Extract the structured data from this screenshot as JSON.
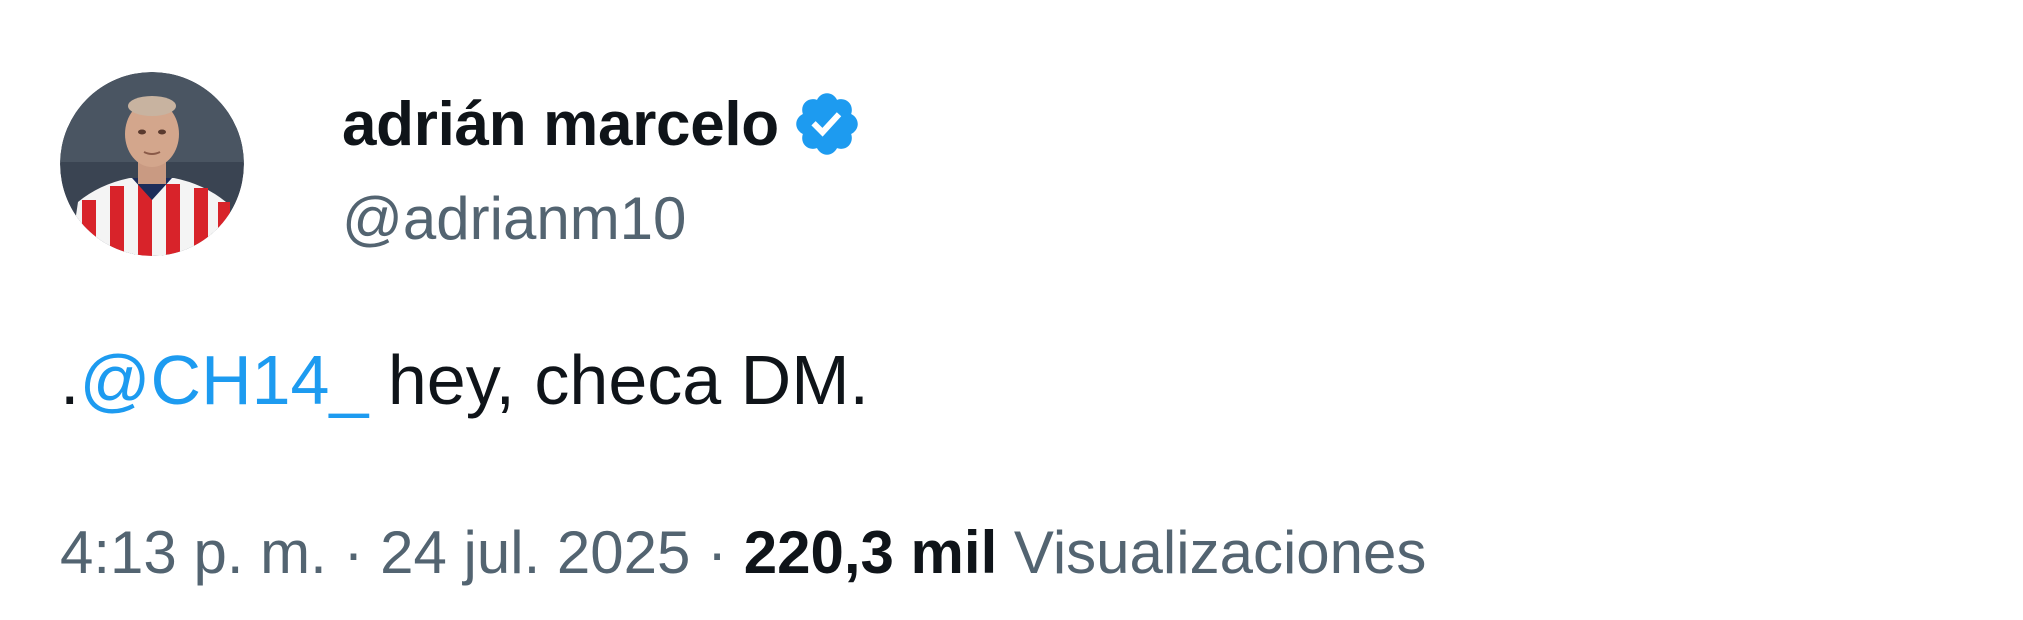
{
  "tweet": {
    "author": {
      "display_name": "adrián marcelo",
      "handle": "@adrianm10",
      "verified": true,
      "avatar_icon": "avatar-photo"
    },
    "text": {
      "prefix": ".",
      "mention": "@CH14_",
      "rest": " hey, checa DM."
    },
    "meta": {
      "time": "4:13 p. m.",
      "separator": " · ",
      "date": "24 jul. 2025",
      "views_count": "220,3 mil",
      "views_label": " Visualizaciones"
    }
  },
  "colors": {
    "text_primary": "#0f1419",
    "text_secondary": "#536471",
    "accent": "#1d9bf0"
  }
}
